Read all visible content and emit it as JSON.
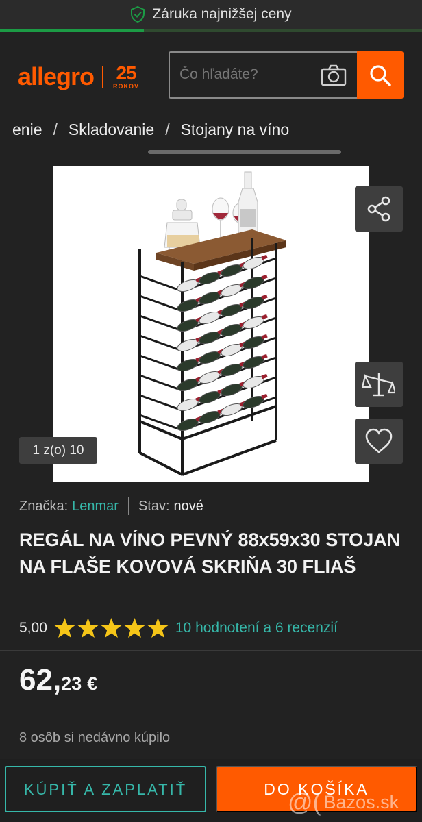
{
  "banner": {
    "text": "Záruka najnižšej ceny",
    "icon": "shield-check-icon"
  },
  "header": {
    "logo_text": "allegro",
    "logo_badge_number": "25",
    "logo_badge_text": "ROKOV",
    "search_placeholder": "Čo hľadáte?"
  },
  "breadcrumb": [
    "enie",
    "Skladovanie",
    "Stojany na víno"
  ],
  "gallery": {
    "counter": "1 z(o) 10"
  },
  "product": {
    "brand_label": "Značka:",
    "brand": "Lenmar",
    "condition_label": "Stav:",
    "condition": "nové",
    "title": "REGÁL NA VÍNO PEVNÝ 88x59x30 STOJAN NA FLAŠE KOVOVÁ SKRIŇA 30 FLIAŠ",
    "rating_score": "5,00",
    "rating_stars": 5,
    "reviews": "10 hodnotení a 6 recenzií",
    "price_main": "62,",
    "price_cents": "23",
    "currency": "€",
    "bought_recently": "8 osôb si nedávno kúpilo"
  },
  "actions": {
    "buy_now": "KÚPIŤ A ZAPLATIŤ",
    "add_to_cart": "DO KOŠÍKA"
  },
  "watermark": {
    "text": "Bazos.sk"
  },
  "colors": {
    "accent": "#ff5a00",
    "link": "#36b7a9",
    "star": "#f5c518",
    "banner_icon": "#1c9b45"
  }
}
